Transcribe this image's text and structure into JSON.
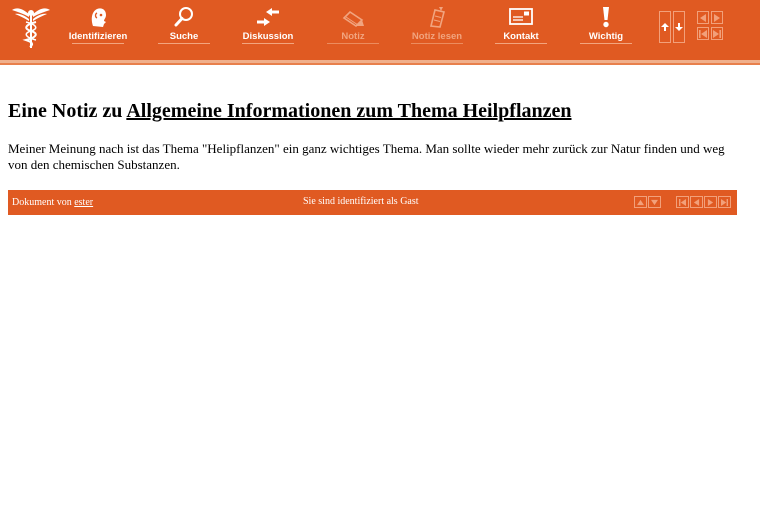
{
  "toolbar": {
    "items": [
      {
        "label": "Identifizieren",
        "icon": "identify-face-icon",
        "enabled": true
      },
      {
        "label": "Suche",
        "icon": "magnifier-icon",
        "enabled": true
      },
      {
        "label": "Diskussion",
        "icon": "discussion-arrows-icon",
        "enabled": true
      },
      {
        "label": "Notiz",
        "icon": "pencil-note-icon",
        "enabled": false
      },
      {
        "label": "Notiz lesen",
        "icon": "note-read-icon",
        "enabled": false
      },
      {
        "label": "Kontakt",
        "icon": "envelope-icon",
        "enabled": true
      },
      {
        "label": "Wichtig",
        "icon": "exclamation-icon",
        "enabled": true
      }
    ]
  },
  "page": {
    "title_prefix": "Eine Notiz zu",
    "title_link": "Allgemeine Informationen zum Thema Heilpflanzen",
    "body": "Meiner Meinung nach ist das Thema \"Helipflanzen\" ein ganz wichtiges Thema. Man sollte wieder mehr zurück zur Natur finden und weg von den chemischen Substanzen."
  },
  "footer": {
    "author_prefix": "Dokument von",
    "author_name": "ester",
    "status": "Sie sind identifiziert als Gast"
  },
  "colors": {
    "brand_orange": "#e05a22",
    "muted_orange": "#f2a07a",
    "text": "#000000",
    "background": "#ffffff"
  }
}
